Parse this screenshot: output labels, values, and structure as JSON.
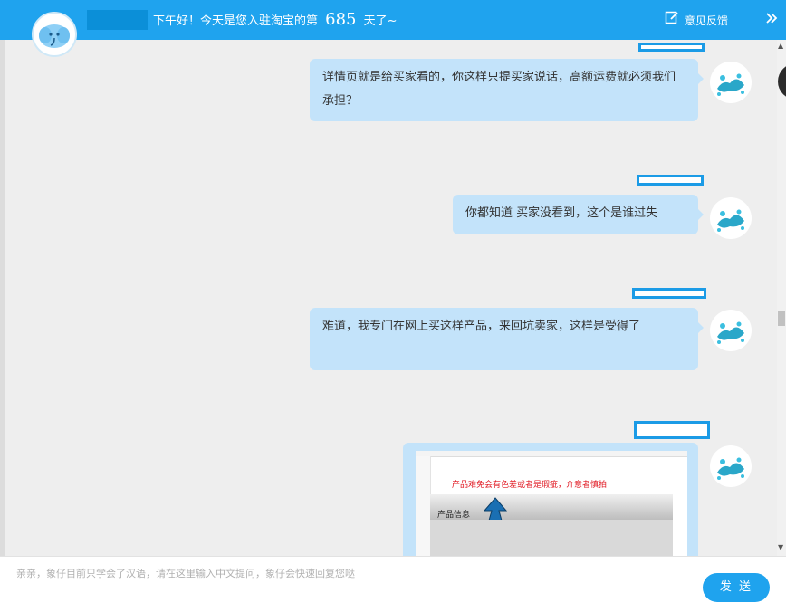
{
  "header": {
    "greeting_prefix": "下午好！今天是您入驻淘宝的第",
    "days": "685",
    "greeting_suffix": "天了~",
    "feedback_label": "意见反馈"
  },
  "messages": [
    {
      "text": "详情页就是给买家看的，你这样只提买家说话，高额运费就必须我们承担？"
    },
    {
      "text": "你都知道 买家没看到，这个是谁过失"
    },
    {
      "text": "难道，我专门在网上买这样产品，来回坑卖家，这样是受得了"
    }
  ],
  "product_image": {
    "warning_text": "产品难免会有色差或者是瑕疵，介意者慎拍",
    "info_label": "产品信息"
  },
  "input": {
    "placeholder": "亲亲，象仔目前只学会了汉语，请在这里输入中文提问，象仔会快速回复您哒"
  },
  "send_label": "发 送",
  "colors": {
    "accent": "#1fa3ee",
    "bubble": "#c3e3fa",
    "background": "#eeeeee",
    "warning": "#e0141e"
  }
}
